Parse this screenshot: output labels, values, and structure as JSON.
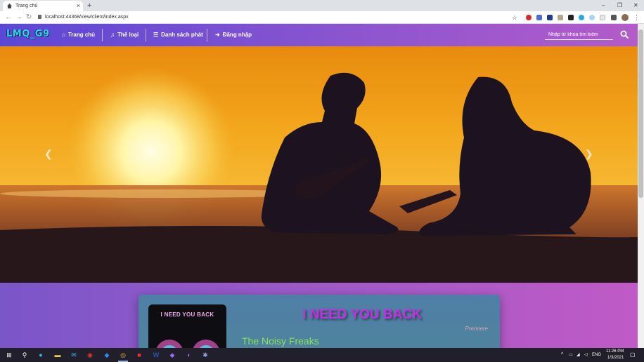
{
  "browser": {
    "tab_title": "Trang chủ",
    "tab_close": "×",
    "new_tab": "+",
    "url": "localhost:44368/view/client/index.aspx",
    "window_controls": {
      "minimize": "–",
      "restore": "❐",
      "close": "✕"
    }
  },
  "site": {
    "logo": "LMQ_G9",
    "nav": [
      {
        "label": "Trang chủ",
        "icon": "home-icon"
      },
      {
        "label": "Thể loại",
        "icon": "music-note-icon"
      },
      {
        "label": "Danh sách phát",
        "icon": "list-icon"
      },
      {
        "label": "Đăng nhập",
        "icon": "sign-in-icon"
      }
    ],
    "search": {
      "placeholder": "Nhập từ khóa tìm kiếm",
      "icon": "search-icon"
    }
  },
  "hero": {
    "prev_icon": "chevron-left-icon",
    "next_icon": "chevron-right-icon"
  },
  "song": {
    "cover_text": "I NEED YOU BACK",
    "title": "I NEED YOU BACK",
    "tag": "Premiere",
    "artist": "The Noisy Freaks"
  },
  "taskbar": {
    "tray_lang": "ENG",
    "time": "11:26 PM",
    "date": "1/3/2021"
  },
  "colors": {
    "nav_start": "#5b47d6",
    "nav_end": "#b45bca",
    "logo": "#34d3e6",
    "song_title": "#c52fe0",
    "artist": "#86e35a"
  }
}
